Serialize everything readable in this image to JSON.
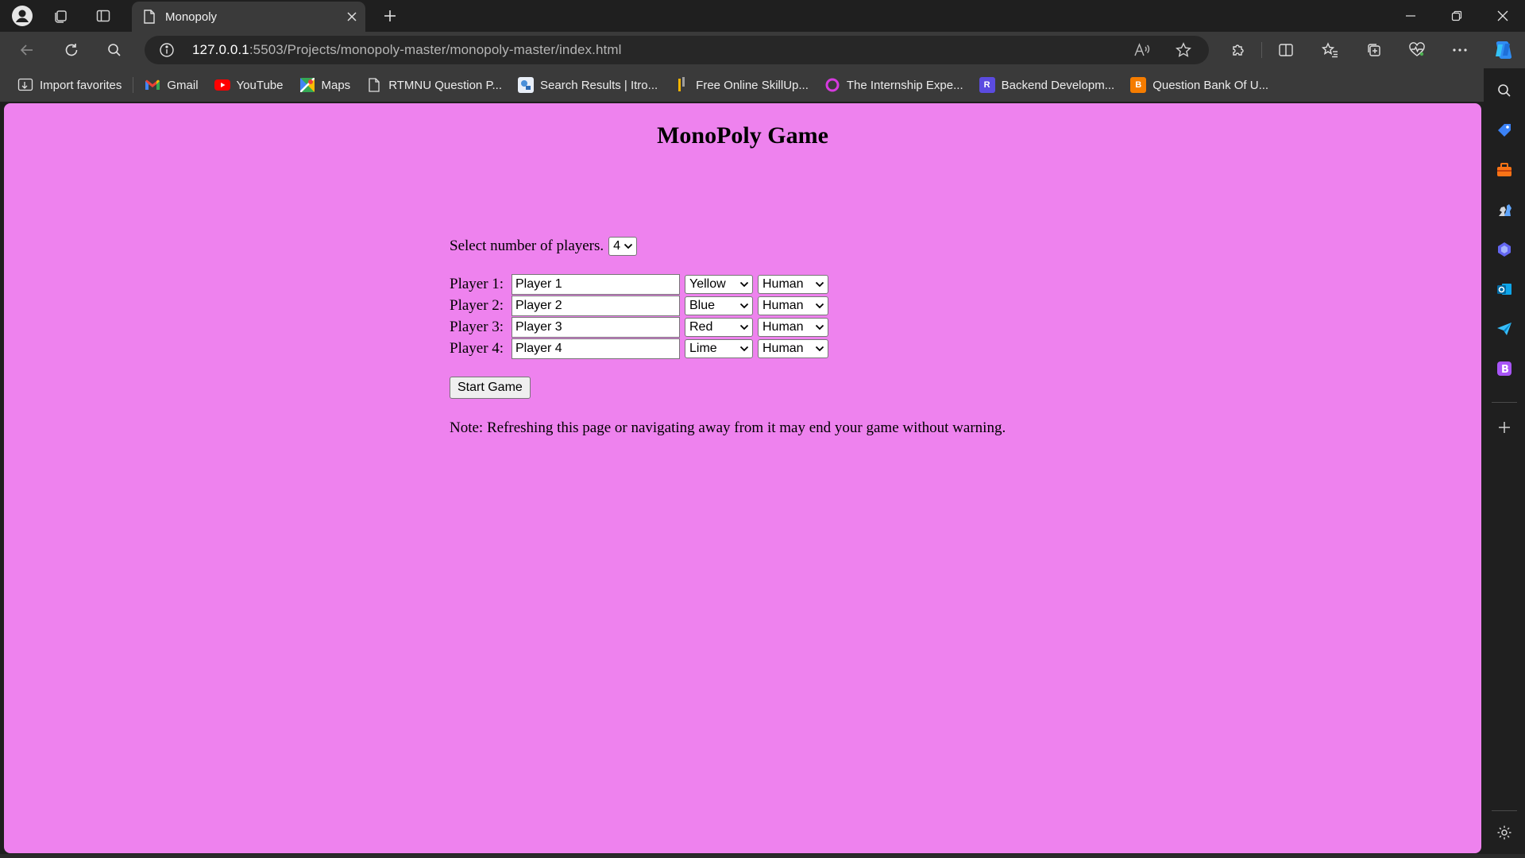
{
  "browser": {
    "tab": {
      "title": "Monopoly"
    },
    "address": {
      "host": "127.0.0.1",
      "path": ":5503/Projects/monopoly-master/monopoly-master/index.html"
    },
    "favorites": [
      {
        "label": "Import favorites",
        "icon": "import-icon",
        "color": "#ececec"
      },
      {
        "label": "Gmail",
        "icon": "gmail-icon",
        "color": "#ea4335"
      },
      {
        "label": "YouTube",
        "icon": "youtube-icon",
        "color": "#ff0000"
      },
      {
        "label": "Maps",
        "icon": "maps-icon",
        "color": "#34a853"
      },
      {
        "label": "RTMNU Question P...",
        "icon": "page-icon",
        "color": "#ececec"
      },
      {
        "label": "Search Results | Itro...",
        "icon": "itro-icon",
        "color": "#4a90d9"
      },
      {
        "label": "Free Online SkillUp...",
        "icon": "skillup-icon",
        "color": "#f4b400"
      },
      {
        "label": "The Internship Expe...",
        "icon": "internship-icon",
        "color": "#d63adf"
      },
      {
        "label": "Backend Developm...",
        "icon": "backend-icon",
        "color": "#5b4be0"
      },
      {
        "label": "Question Bank Of U...",
        "icon": "blogger-icon",
        "color": "#f57c00"
      }
    ]
  },
  "page": {
    "title": "MonoPoly Game",
    "player_count_label": "Select number of players.",
    "player_count_value": "4",
    "players": [
      {
        "label": "Player 1:",
        "name": "Player 1",
        "color": "Yellow",
        "type": "Human"
      },
      {
        "label": "Player 2:",
        "name": "Player 2",
        "color": "Blue",
        "type": "Human"
      },
      {
        "label": "Player 3:",
        "name": "Player 3",
        "color": "Red",
        "type": "Human"
      },
      {
        "label": "Player 4:",
        "name": "Player 4",
        "color": "Lime",
        "type": "Human"
      }
    ],
    "start_button": "Start Game",
    "note": "Note: Refreshing this page or navigating away from it may end your game without warning.",
    "background_color": "#ee82ee"
  }
}
